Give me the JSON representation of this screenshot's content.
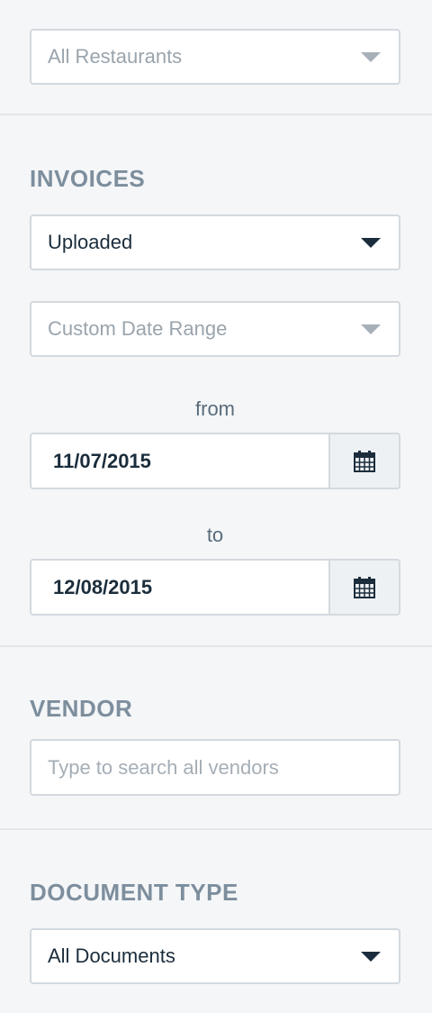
{
  "restaurant_filter": {
    "value": "All Restaurants"
  },
  "invoices": {
    "heading": "INVOICES",
    "status_select": {
      "value": "Uploaded"
    },
    "date_range_select": {
      "value": "Custom Date Range"
    },
    "from_label": "from",
    "from_date": "11/07/2015",
    "to_label": "to",
    "to_date": "12/08/2015"
  },
  "vendor": {
    "heading": "VENDOR",
    "search_placeholder": "Type to search all vendors"
  },
  "document_type": {
    "heading": "DOCUMENT TYPE",
    "select": {
      "value": "All Documents"
    }
  },
  "icons": {
    "select_caret": "caret-down-icon",
    "date_picker": "calendar-icon"
  },
  "colors": {
    "background": "#f4f6f8",
    "heading": "#7d8e9d",
    "text": "#1b2d3c",
    "muted_text": "#9aa4ad",
    "border": "#d3d9df"
  }
}
